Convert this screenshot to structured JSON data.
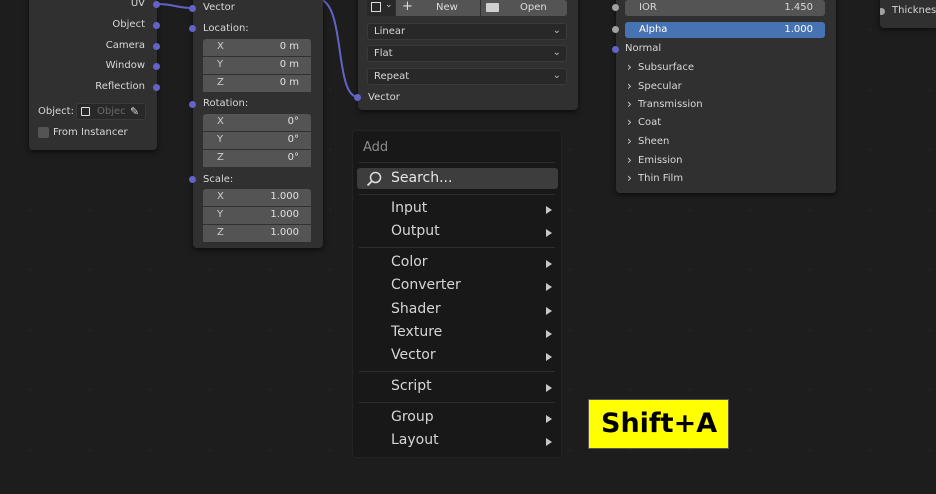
{
  "texture_coord_node": {
    "outputs": [
      "UV",
      "Object",
      "Camera",
      "Window",
      "Reflection"
    ],
    "object_label": "Object:",
    "object_placeholder": "Objec",
    "from_instancer_label": "From Instancer"
  },
  "mapping_node": {
    "vector_label": "Vector",
    "location_label": "Location:",
    "rotation_label": "Rotation:",
    "scale_label": "Scale:",
    "location": [
      {
        "axis": "X",
        "value": "0 m"
      },
      {
        "axis": "Y",
        "value": "0 m"
      },
      {
        "axis": "Z",
        "value": "0 m"
      }
    ],
    "rotation": [
      {
        "axis": "X",
        "value": "0°"
      },
      {
        "axis": "Y",
        "value": "0°"
      },
      {
        "axis": "Z",
        "value": "0°"
      }
    ],
    "scale": [
      {
        "axis": "X",
        "value": "1.000"
      },
      {
        "axis": "Y",
        "value": "1.000"
      },
      {
        "axis": "Z",
        "value": "1.000"
      }
    ]
  },
  "image_texture_node": {
    "new_label": "New",
    "open_label": "Open",
    "interpolation": "Linear",
    "projection": "Flat",
    "extension": "Repeat",
    "vector_label": "Vector"
  },
  "bsdf_node": {
    "ior_label": "IOR",
    "ior_value": "1.450",
    "alpha_label": "Alpha",
    "alpha_value": "1.000",
    "normal_label": "Normal",
    "panels": [
      "Subsurface",
      "Specular",
      "Transmission",
      "Coat",
      "Sheen",
      "Emission",
      "Thin Film"
    ]
  },
  "output_node": {
    "thickness_label": "Thickness"
  },
  "add_menu": {
    "title": "Add",
    "search_label": "Search...",
    "groups": [
      [
        "Input",
        "Output"
      ],
      [
        "Color",
        "Converter",
        "Shader",
        "Texture",
        "Vector"
      ],
      [
        "Script"
      ],
      [
        "Group",
        "Layout"
      ]
    ]
  },
  "shortcut_badge": "Shift+A",
  "colors": {
    "socket_vector": "#6363c7",
    "socket_float": "#a1a1a1",
    "alpha_highlight": "#4772b3",
    "badge_bg": "#ffff00"
  }
}
